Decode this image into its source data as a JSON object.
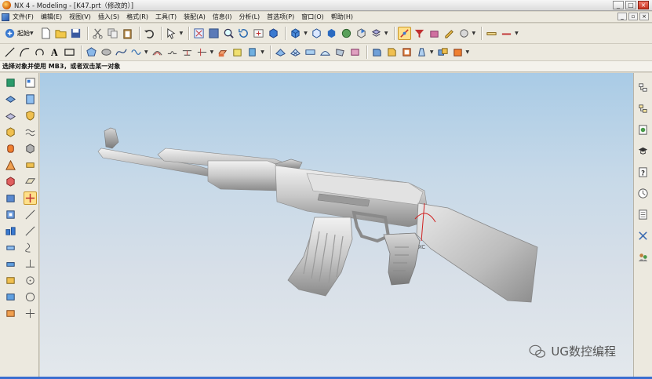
{
  "window": {
    "title": "NX 4 - Modeling - [K47.prt（修改的）]"
  },
  "menubar": {
    "items": [
      "文件(F)",
      "编辑(E)",
      "视图(V)",
      "插入(S)",
      "格式(R)",
      "工具(T)",
      "装配(A)",
      "信息(I)",
      "分析(L)",
      "首选项(P)",
      "窗口(O)",
      "帮助(H)"
    ]
  },
  "toolbar": {
    "start_label": "起始"
  },
  "status": {
    "prompt": "选择对象并使用 MB3，或者双击某一对象"
  },
  "watermark": {
    "text": "UG数控编程"
  },
  "colors": {
    "viewport_top": "#a9cbe6",
    "viewport_bottom": "#e3e8ec",
    "model": "#c8c8c8",
    "ui_bg": "#ece9df"
  }
}
